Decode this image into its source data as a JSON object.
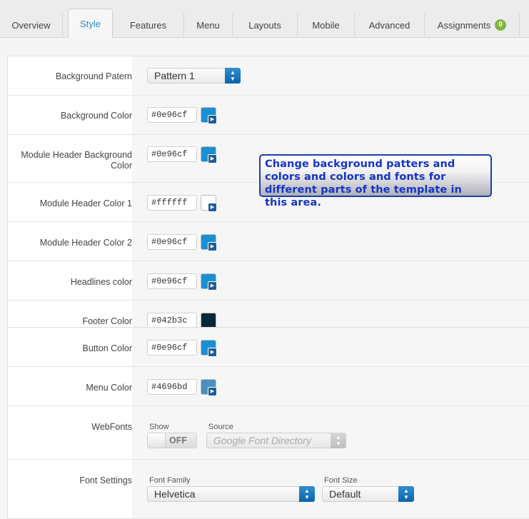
{
  "tabs": [
    {
      "label": "Overview"
    },
    {
      "label": "Style"
    },
    {
      "label": "Features"
    },
    {
      "label": "Menu"
    },
    {
      "label": "Layouts"
    },
    {
      "label": "Mobile"
    },
    {
      "label": "Advanced"
    },
    {
      "label": "Assignments",
      "badge": "0"
    }
  ],
  "active_tab": "Style",
  "rows": {
    "background_pattern": {
      "label": "Background Patern",
      "value": "Pattern 1"
    },
    "background_color": {
      "label": "Background Color",
      "value": "#0e96cf",
      "swatch": "#1a8fd2"
    },
    "module_header_bg": {
      "label": "Module Header Background Color",
      "value": "#0e96cf",
      "swatch": "#1a8fd2"
    },
    "module_header_color1": {
      "label": "Module Header Color 1",
      "value": "#ffffff",
      "swatch": "#ffffff"
    },
    "module_header_color2": {
      "label": "Module Header Color 2",
      "value": "#0e96cf",
      "swatch": "#1a8fd2"
    },
    "headlines_color": {
      "label": "Headlines color",
      "value": "#0e96cf",
      "swatch": "#1a8fd2"
    },
    "footer_color": {
      "label": "Footer Color",
      "value": "#042b3c",
      "swatch": "#082838"
    },
    "button_color": {
      "label": "Button Color",
      "value": "#0e96cf",
      "swatch": "#1a8fd2"
    },
    "menu_color": {
      "label": "Menu Color",
      "value": "#4696bd",
      "swatch": "#4b91bd"
    },
    "webfonts": {
      "label": "WebFonts",
      "show_label": "Show",
      "toggle": "OFF",
      "source_label": "Source",
      "source_value": "Google Font Directory"
    },
    "font_settings": {
      "label": "Font Settings",
      "family_label": "Font Family",
      "family_value": "Helvetica",
      "size_label": "Font Size",
      "size_value": "Default"
    }
  },
  "tooltip": {
    "text": "Change background patters and colors and colors and fonts for different parts of the template in this area."
  }
}
